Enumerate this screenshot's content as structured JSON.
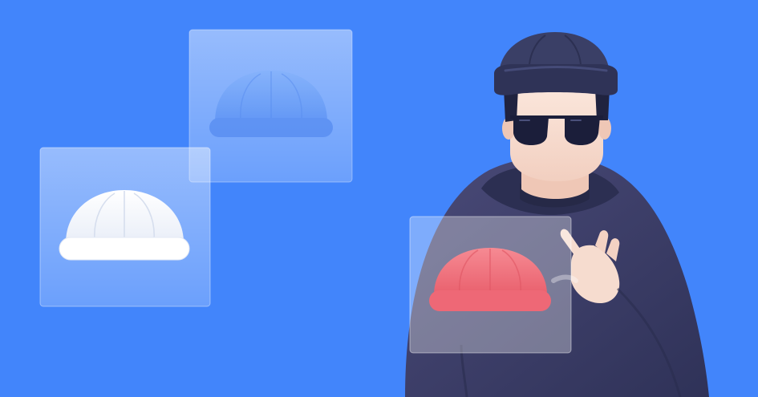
{
  "scene": {
    "background_color": "#4285FB",
    "panel_color": "#FFFFFF",
    "hat_colors": {
      "white_hat": "#FFFFFF",
      "blue_hat": "#6FA3FA",
      "red_hat": "#F0707C"
    },
    "figure": {
      "beanie_color": "#3A3F66",
      "hoodie_color": "#3D3E6A",
      "skin_color": "#F6DCCF",
      "hair_color": "#20233F",
      "sunglasses_color": "#1B1E3A"
    },
    "icons": [
      "white-beanie-icon",
      "blue-beanie-icon",
      "red-beanie-icon"
    ]
  }
}
